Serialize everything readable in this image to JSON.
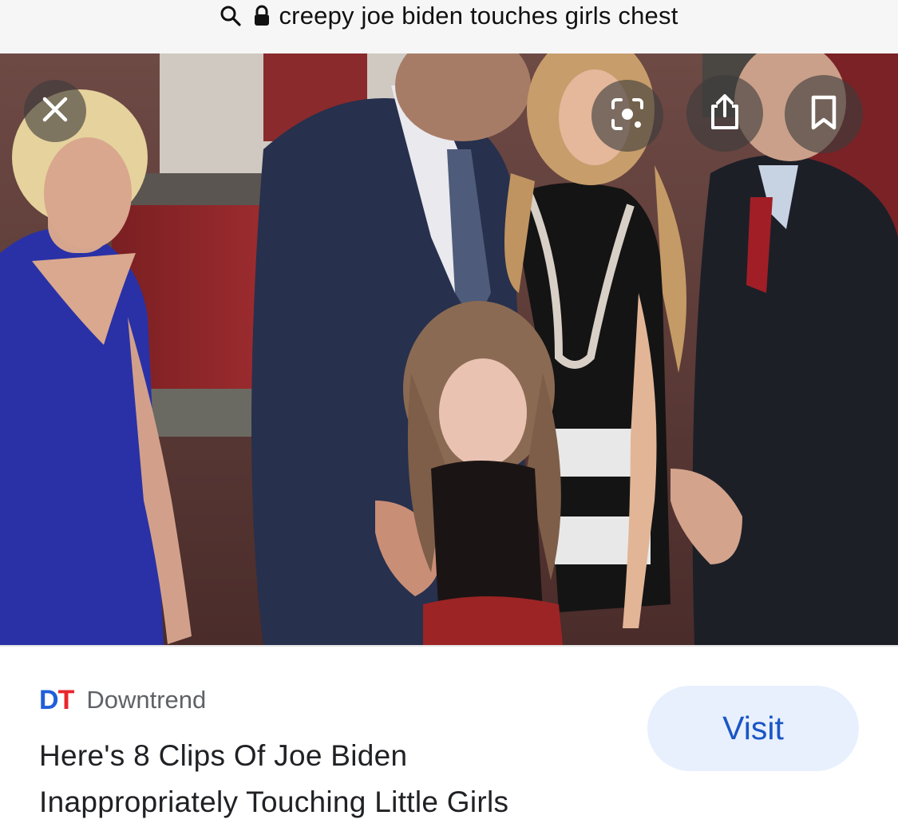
{
  "search": {
    "query": "creepy joe biden touches girls chest",
    "search_icon": "search-icon",
    "lock_icon": "lock-icon"
  },
  "viewer": {
    "close_icon": "close-icon",
    "lens_icon": "lens-icon",
    "share_icon": "share-icon",
    "save_icon": "bookmark-icon"
  },
  "result": {
    "source_logo_d": "D",
    "source_logo_t": "T",
    "source_name": "Downtrend",
    "title_line1": "Here's 8 Clips Of Joe Biden",
    "title_line2": "Inappropriately Touching Little Girls",
    "visit_label": "Visit",
    "colors": {
      "logo_d": "#1f5fd8",
      "logo_t": "#e8262b",
      "visit_bg": "#e8f0fe",
      "visit_text": "#1a56c4"
    }
  }
}
